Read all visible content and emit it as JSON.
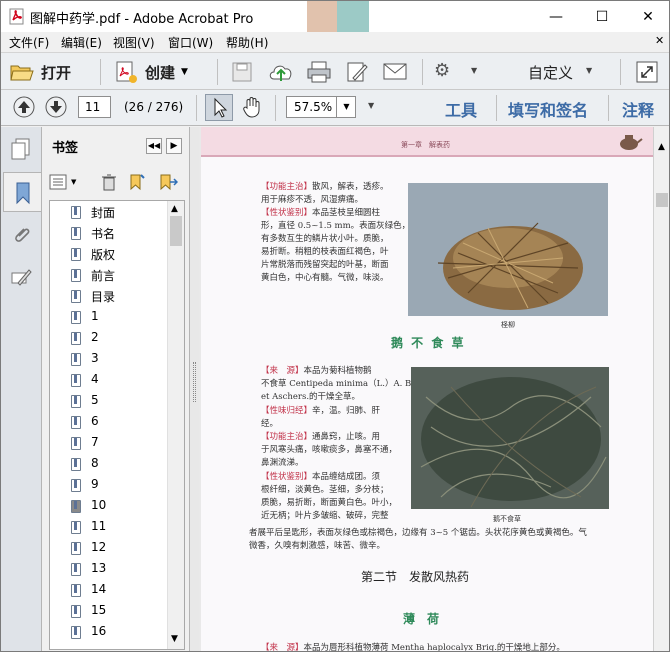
{
  "window": {
    "title": "图解中药学.pdf - Adobe Acrobat Pro",
    "minimize_label": "—",
    "maximize_label": "☐",
    "close_label": "✕"
  },
  "menu": {
    "items": [
      "文件(F)",
      "编辑(E)",
      "视图(V)",
      "窗口(W)",
      "帮助(H)"
    ],
    "close_doc": "✕"
  },
  "toolbar": {
    "open_label": "打开",
    "create_label": "创建",
    "customize_label": "自定义"
  },
  "nav": {
    "page_value": "11",
    "page_count": "(26 / 276)",
    "zoom_value": "57.5%",
    "tools_label": "工具",
    "fill_sign_label": "填写和签名",
    "comment_label": "注释"
  },
  "bookmarks": {
    "panel_title": "书签",
    "selected_index": 14,
    "items": [
      "封面",
      "书名",
      "版权",
      "前言",
      "目录",
      "1",
      "2",
      "3",
      "4",
      "5",
      "6",
      "7",
      "8",
      "9",
      "10",
      "11",
      "12",
      "13",
      "14",
      "15",
      "16"
    ]
  },
  "page": {
    "header_text": "第一章　解表药",
    "block1": {
      "lines": [
        {
          "tag": "【功能主治】",
          "text": "散风，解表，透疹。"
        },
        {
          "tag": "",
          "text": "用于麻疹不透，风湿痹痛。"
        },
        {
          "tag": "【性状鉴别】",
          "text": "本品茎枝呈细圆柱"
        },
        {
          "tag": "",
          "text": "形，直径 0.5~1.5 mm。表面灰绿色，"
        },
        {
          "tag": "",
          "text": "有多数互生的鳞片状小叶。质脆，"
        },
        {
          "tag": "",
          "text": "易折断。稍粗的枝表面红褐色，叶"
        },
        {
          "tag": "",
          "text": "片常脱落而残留突起的叶基，断面"
        },
        {
          "tag": "",
          "text": "黄白色，中心有髓。气微，味淡。"
        }
      ],
      "caption": "柽柳"
    },
    "section1_heading": "鹅 不 食 草",
    "block2": {
      "lines": [
        {
          "tag": "【来　源】",
          "text": "本品为菊科植物鹅"
        },
        {
          "tag": "",
          "text": "不食草 Centipeda minima（L.）A. Br."
        },
        {
          "tag": "",
          "text": "et Aschers.的干燥全草。"
        },
        {
          "tag": "【性味归经】",
          "text": "辛，温。归肺、肝"
        },
        {
          "tag": "",
          "text": "经。"
        },
        {
          "tag": "【功能主治】",
          "text": "通鼻窍，止咳。用"
        },
        {
          "tag": "",
          "text": "于风寒头痛，咳嗽痰多，鼻塞不通，"
        },
        {
          "tag": "",
          "text": "鼻渊流涕。"
        },
        {
          "tag": "【性状鉴别】",
          "text": "本品缠结成团。须"
        },
        {
          "tag": "",
          "text": "根纤细，淡黄色。茎细，多分枝；"
        },
        {
          "tag": "",
          "text": "质脆，易折断，断面黄白色。叶小，"
        },
        {
          "tag": "",
          "text": "近无柄；叶片多皱缩、破碎，完整"
        }
      ],
      "caption": "鹅不食草",
      "full_lines": [
        "者展平后呈匙形，表面灰绿色或棕褐色，边缘有 3~5 个锯齿。头状花序黄色或黄褐色。气",
        "微香，久嗅有刺激感，味苦、微辛。"
      ]
    },
    "section_title": "第二节　发散风热药",
    "section2_heading": "薄　荷",
    "block3_line": {
      "tag": "【来　源】",
      "text": "本品为唇形科植物薄荷 Mentha haplocalyx Briq.的干燥地上部分。"
    }
  }
}
